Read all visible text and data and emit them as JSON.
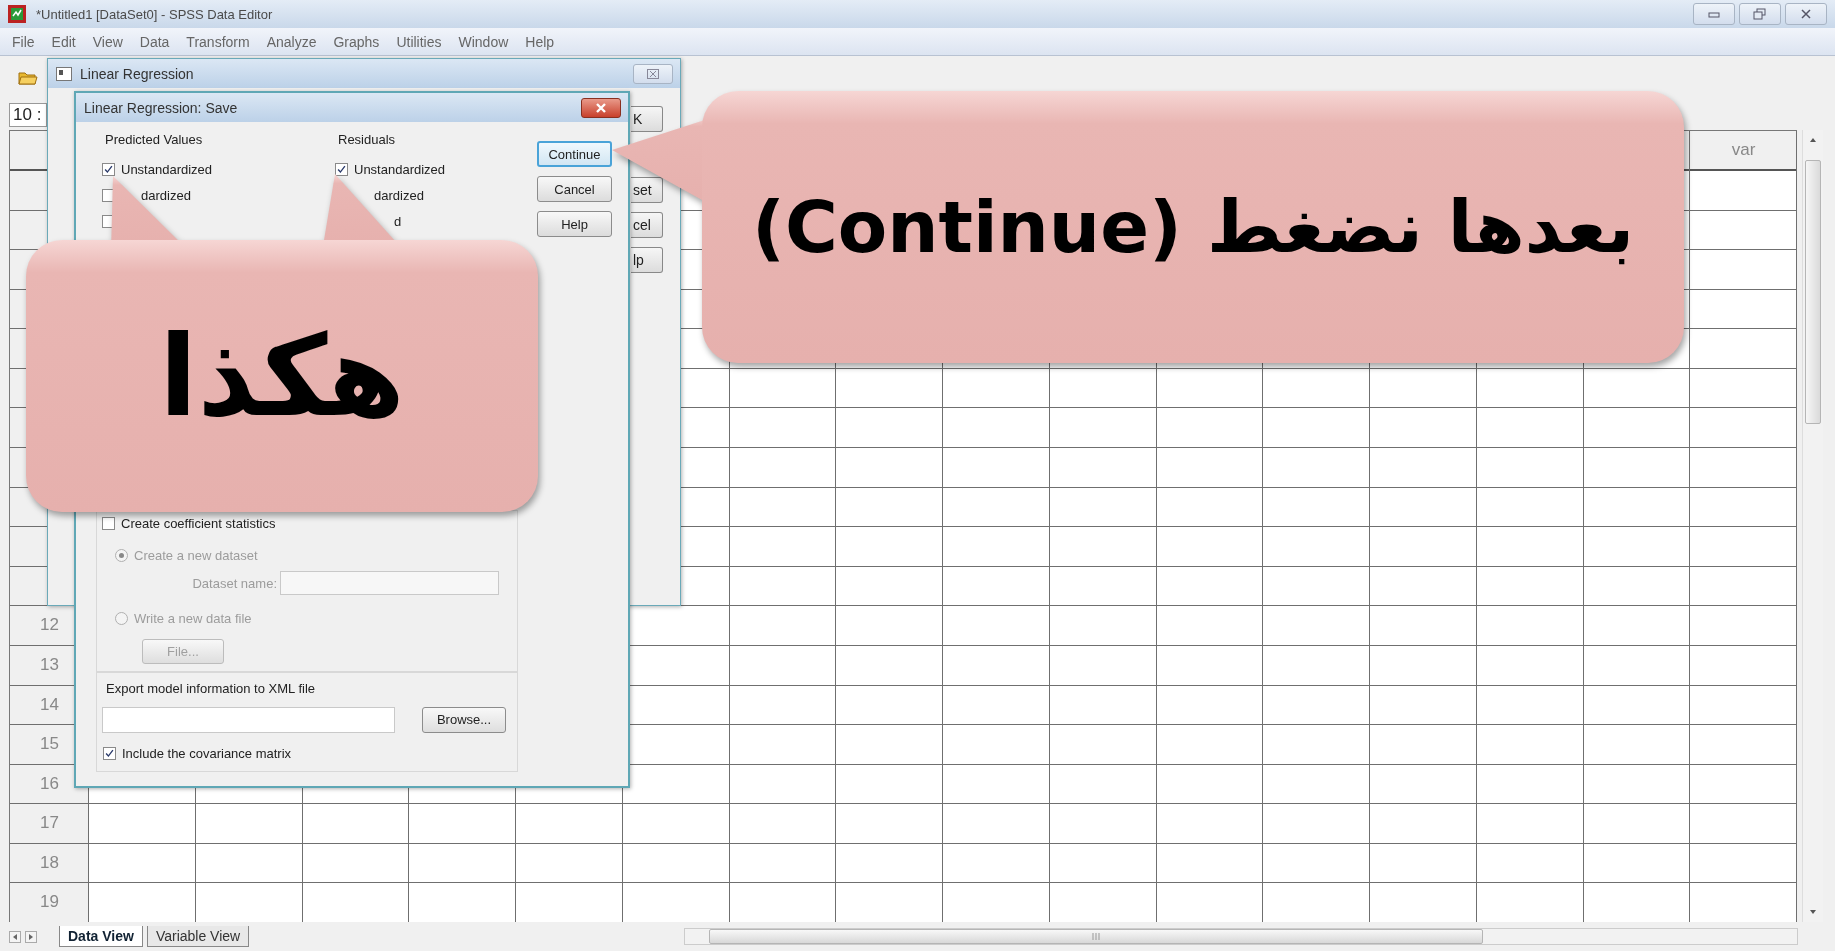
{
  "window": {
    "title": "*Untitled1 [DataSet0] - SPSS Data Editor"
  },
  "menu": [
    "File",
    "Edit",
    "View",
    "Data",
    "Transform",
    "Analyze",
    "Graphs",
    "Utilities",
    "Window",
    "Help"
  ],
  "cell_editor": {
    "cell": "10 :"
  },
  "grid": {
    "column_header": "var",
    "row_numbers": [
      "12",
      "13",
      "14",
      "15",
      "16",
      "17",
      "18",
      "19"
    ]
  },
  "regression_dialog": {
    "title": "Linear Regression",
    "buttons": [
      "K",
      "set",
      "cel",
      "lp"
    ]
  },
  "save_dialog": {
    "title": "Linear Regression: Save",
    "predicted_values": {
      "title": "Predicted Values",
      "options": [
        {
          "label": "Unstandardized",
          "checked": true
        },
        {
          "label": "dardized",
          "checked": false
        },
        {
          "checked": false
        }
      ]
    },
    "residuals": {
      "title": "Residuals",
      "options": [
        {
          "label": "Unstandardized",
          "checked": true
        },
        {
          "label": "dardized"
        },
        {
          "label": "d"
        }
      ]
    },
    "coefficient_statistics": {
      "label": "Create coefficient statistics",
      "checked": false
    },
    "destinations": [
      {
        "label": "Create a new dataset",
        "selected": true,
        "disabled": true
      },
      {
        "label": "Write a new data file",
        "selected": false,
        "disabled": true
      }
    ],
    "dataset_name": {
      "label": "Dataset name:",
      "disabled": true
    },
    "file_button": {
      "label": "File...",
      "disabled": true
    },
    "export": {
      "label": "Export model information to XML file",
      "button": "Browse..."
    },
    "covariance": {
      "label": "Include the covariance matrix",
      "checked": true
    },
    "buttons": [
      {
        "label": "Continue",
        "focused": true
      },
      {
        "label": "Cancel",
        "focused": false
      },
      {
        "label": "Help",
        "focused": false
      }
    ]
  },
  "callouts": [
    {
      "text": "هكذا"
    },
    {
      "text": "بعدها نضغط (Continue)"
    }
  ],
  "sheet_tabs": [
    {
      "label": "Data View",
      "selected": true
    },
    {
      "label": "Variable View",
      "selected": false
    }
  ]
}
